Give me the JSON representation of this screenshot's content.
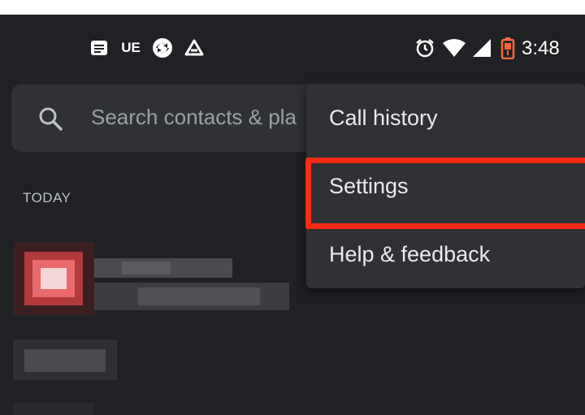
{
  "status_bar": {
    "time": "3:48",
    "left_icons": [
      "notes-icon",
      "ue-icon",
      "sync-icon",
      "drive-icon"
    ],
    "ue_text": "UE",
    "right_icons": [
      "alarm-icon",
      "wifi-icon",
      "signal-icon",
      "battery-icon"
    ]
  },
  "search": {
    "placeholder": "Search contacts & pla"
  },
  "section": {
    "today_label": "TODAY"
  },
  "menu": {
    "items": [
      {
        "label": "Call history"
      },
      {
        "label": "Settings"
      },
      {
        "label": "Help & feedback"
      }
    ]
  },
  "colors": {
    "background": "#202124",
    "surface": "#303134",
    "highlight": "#ff2a12"
  }
}
